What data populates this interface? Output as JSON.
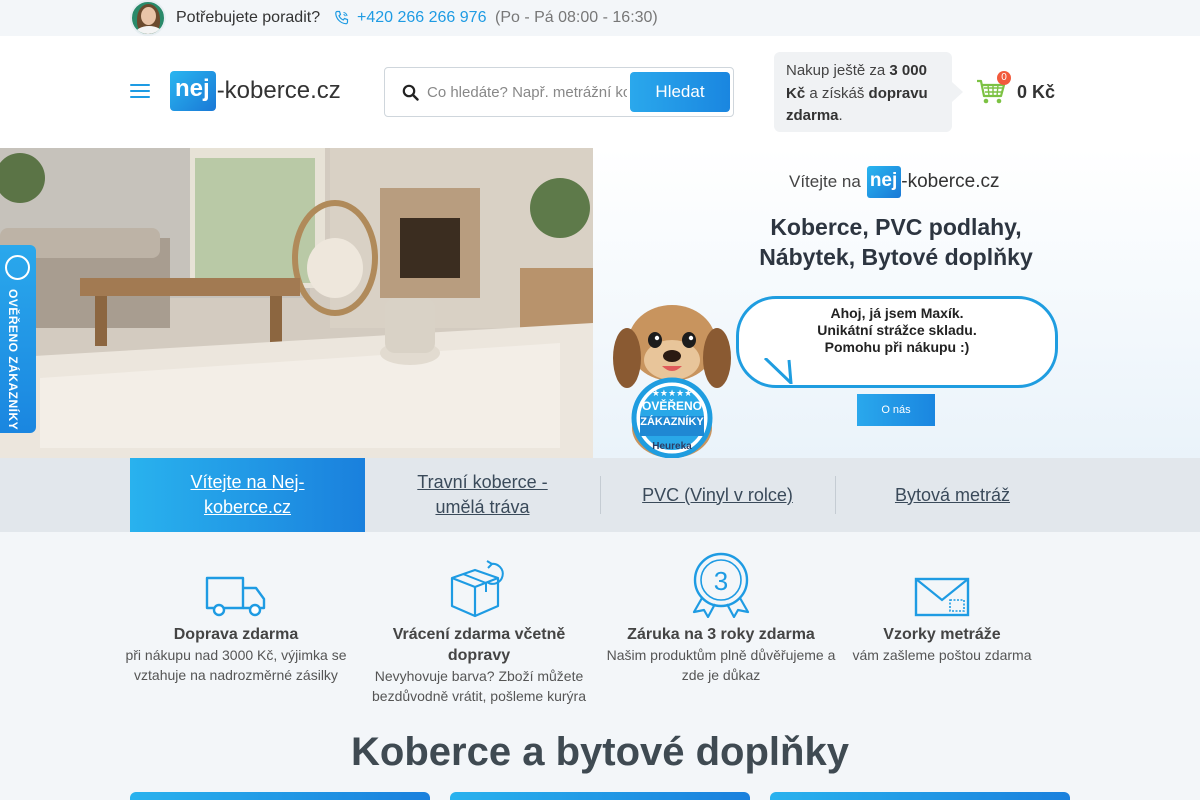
{
  "topbar": {
    "help_text": "Potřebujete poradit?",
    "phone": "+420 266 266 976",
    "hours": "(Po - Pá 08:00 - 16:30)"
  },
  "header": {
    "logo_badge": "nej",
    "logo_rest": "-koberce.cz",
    "search_placeholder": "Co hledáte? Např. metrážní koberce",
    "search_button": "Hledat",
    "freeship_prefix": "Nakup ještě za ",
    "freeship_amount": "3 000 Kč",
    "freeship_mid": " a získáš ",
    "freeship_bold": "dopravu zdarma",
    "freeship_suffix": ".",
    "cart_count": "0",
    "cart_total": "0 Kč"
  },
  "hero": {
    "welcome_prefix": "Vítejte na",
    "welcome_badge": "nej",
    "welcome_rest": "-koberce.cz",
    "headline_line1": "Koberce, PVC podlahy,",
    "headline_line2": "Nábytek, Bytové doplňky",
    "bubble_line1": "Ahoj, já jsem Maxík.",
    "bubble_line2": "Unikátní strážce skladu.",
    "bubble_line3": "Pomohu při nákupu :)",
    "button": "O nás",
    "dog_badge_line1": "OVĚŘENO",
    "dog_badge_line2": "ZÁKAZNÍKY",
    "dog_badge_brand": "Heureka"
  },
  "verified_tab": "OVĚŘENO ZÁKAZNÍKY",
  "categories": [
    {
      "label": "Vítejte na Nej-koberce.cz",
      "active": true
    },
    {
      "label": "Travní koberce - umělá tráva",
      "active": false
    },
    {
      "label": "PVC (Vinyl v rolce)",
      "active": false
    },
    {
      "label": "Bytová metráž",
      "active": false
    }
  ],
  "benefits": [
    {
      "icon": "truck-icon",
      "title": "Doprava zdarma",
      "desc": "při nákupu nad 3000 Kč, výjimka se vztahuje na nadrozměrné zásilky"
    },
    {
      "icon": "return-box-icon",
      "title": "Vrácení zdarma včetně dopravy",
      "desc": "Nevyhovuje barva? Zboží můžete bezdůvodně vrátit, pošleme kurýra"
    },
    {
      "icon": "warranty-medal-icon",
      "title": "Záruka na 3 roky zdarma",
      "desc": "Našim produktům plně důvěřujeme a zde je důkaz"
    },
    {
      "icon": "envelope-icon",
      "title": "Vzorky metráže",
      "desc": "vám zašleme poštou zdarma"
    }
  ],
  "warranty_number": "3",
  "section_title": "Koberce a bytové doplňky",
  "colors": {
    "accent": "#1e9be3",
    "cart_badge": "#f25a3c"
  }
}
